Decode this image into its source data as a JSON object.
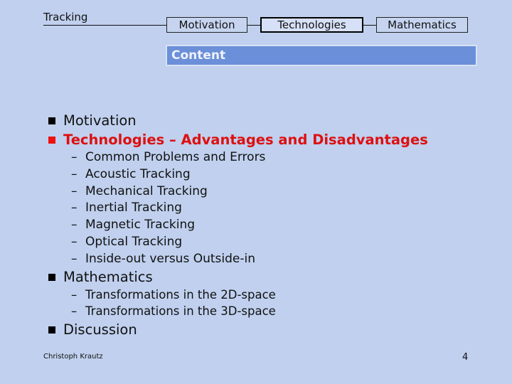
{
  "nav": {
    "title": "Tracking",
    "tabs": [
      {
        "label": "Motivation",
        "active": false
      },
      {
        "label": "Technologies",
        "active": true
      },
      {
        "label": "Mathematics",
        "active": false
      }
    ]
  },
  "section": {
    "title": "Content"
  },
  "outline": [
    {
      "label": "Motivation",
      "current": false,
      "subitems": []
    },
    {
      "label": "Technologies – Advantages and Disadvantages",
      "current": true,
      "subitems": [
        "Common Problems and Errors",
        "Acoustic Tracking",
        "Mechanical Tracking",
        "Inertial Tracking",
        "Magnetic Tracking",
        "Optical Tracking",
        "Inside-out versus Outside-in"
      ]
    },
    {
      "label": "Mathematics",
      "current": false,
      "subitems": [
        "Transformations in the 2D-space",
        "Transformations in the 3D-space"
      ]
    },
    {
      "label": "Discussion",
      "current": false,
      "subitems": []
    }
  ],
  "sub_bullet": "–",
  "footer": {
    "author": "Christoph Krautz",
    "page_number": "4"
  },
  "colors": {
    "background": "#c0d0ee",
    "section_bar": "#6b8fd9",
    "highlight_text": "#dd1010"
  }
}
